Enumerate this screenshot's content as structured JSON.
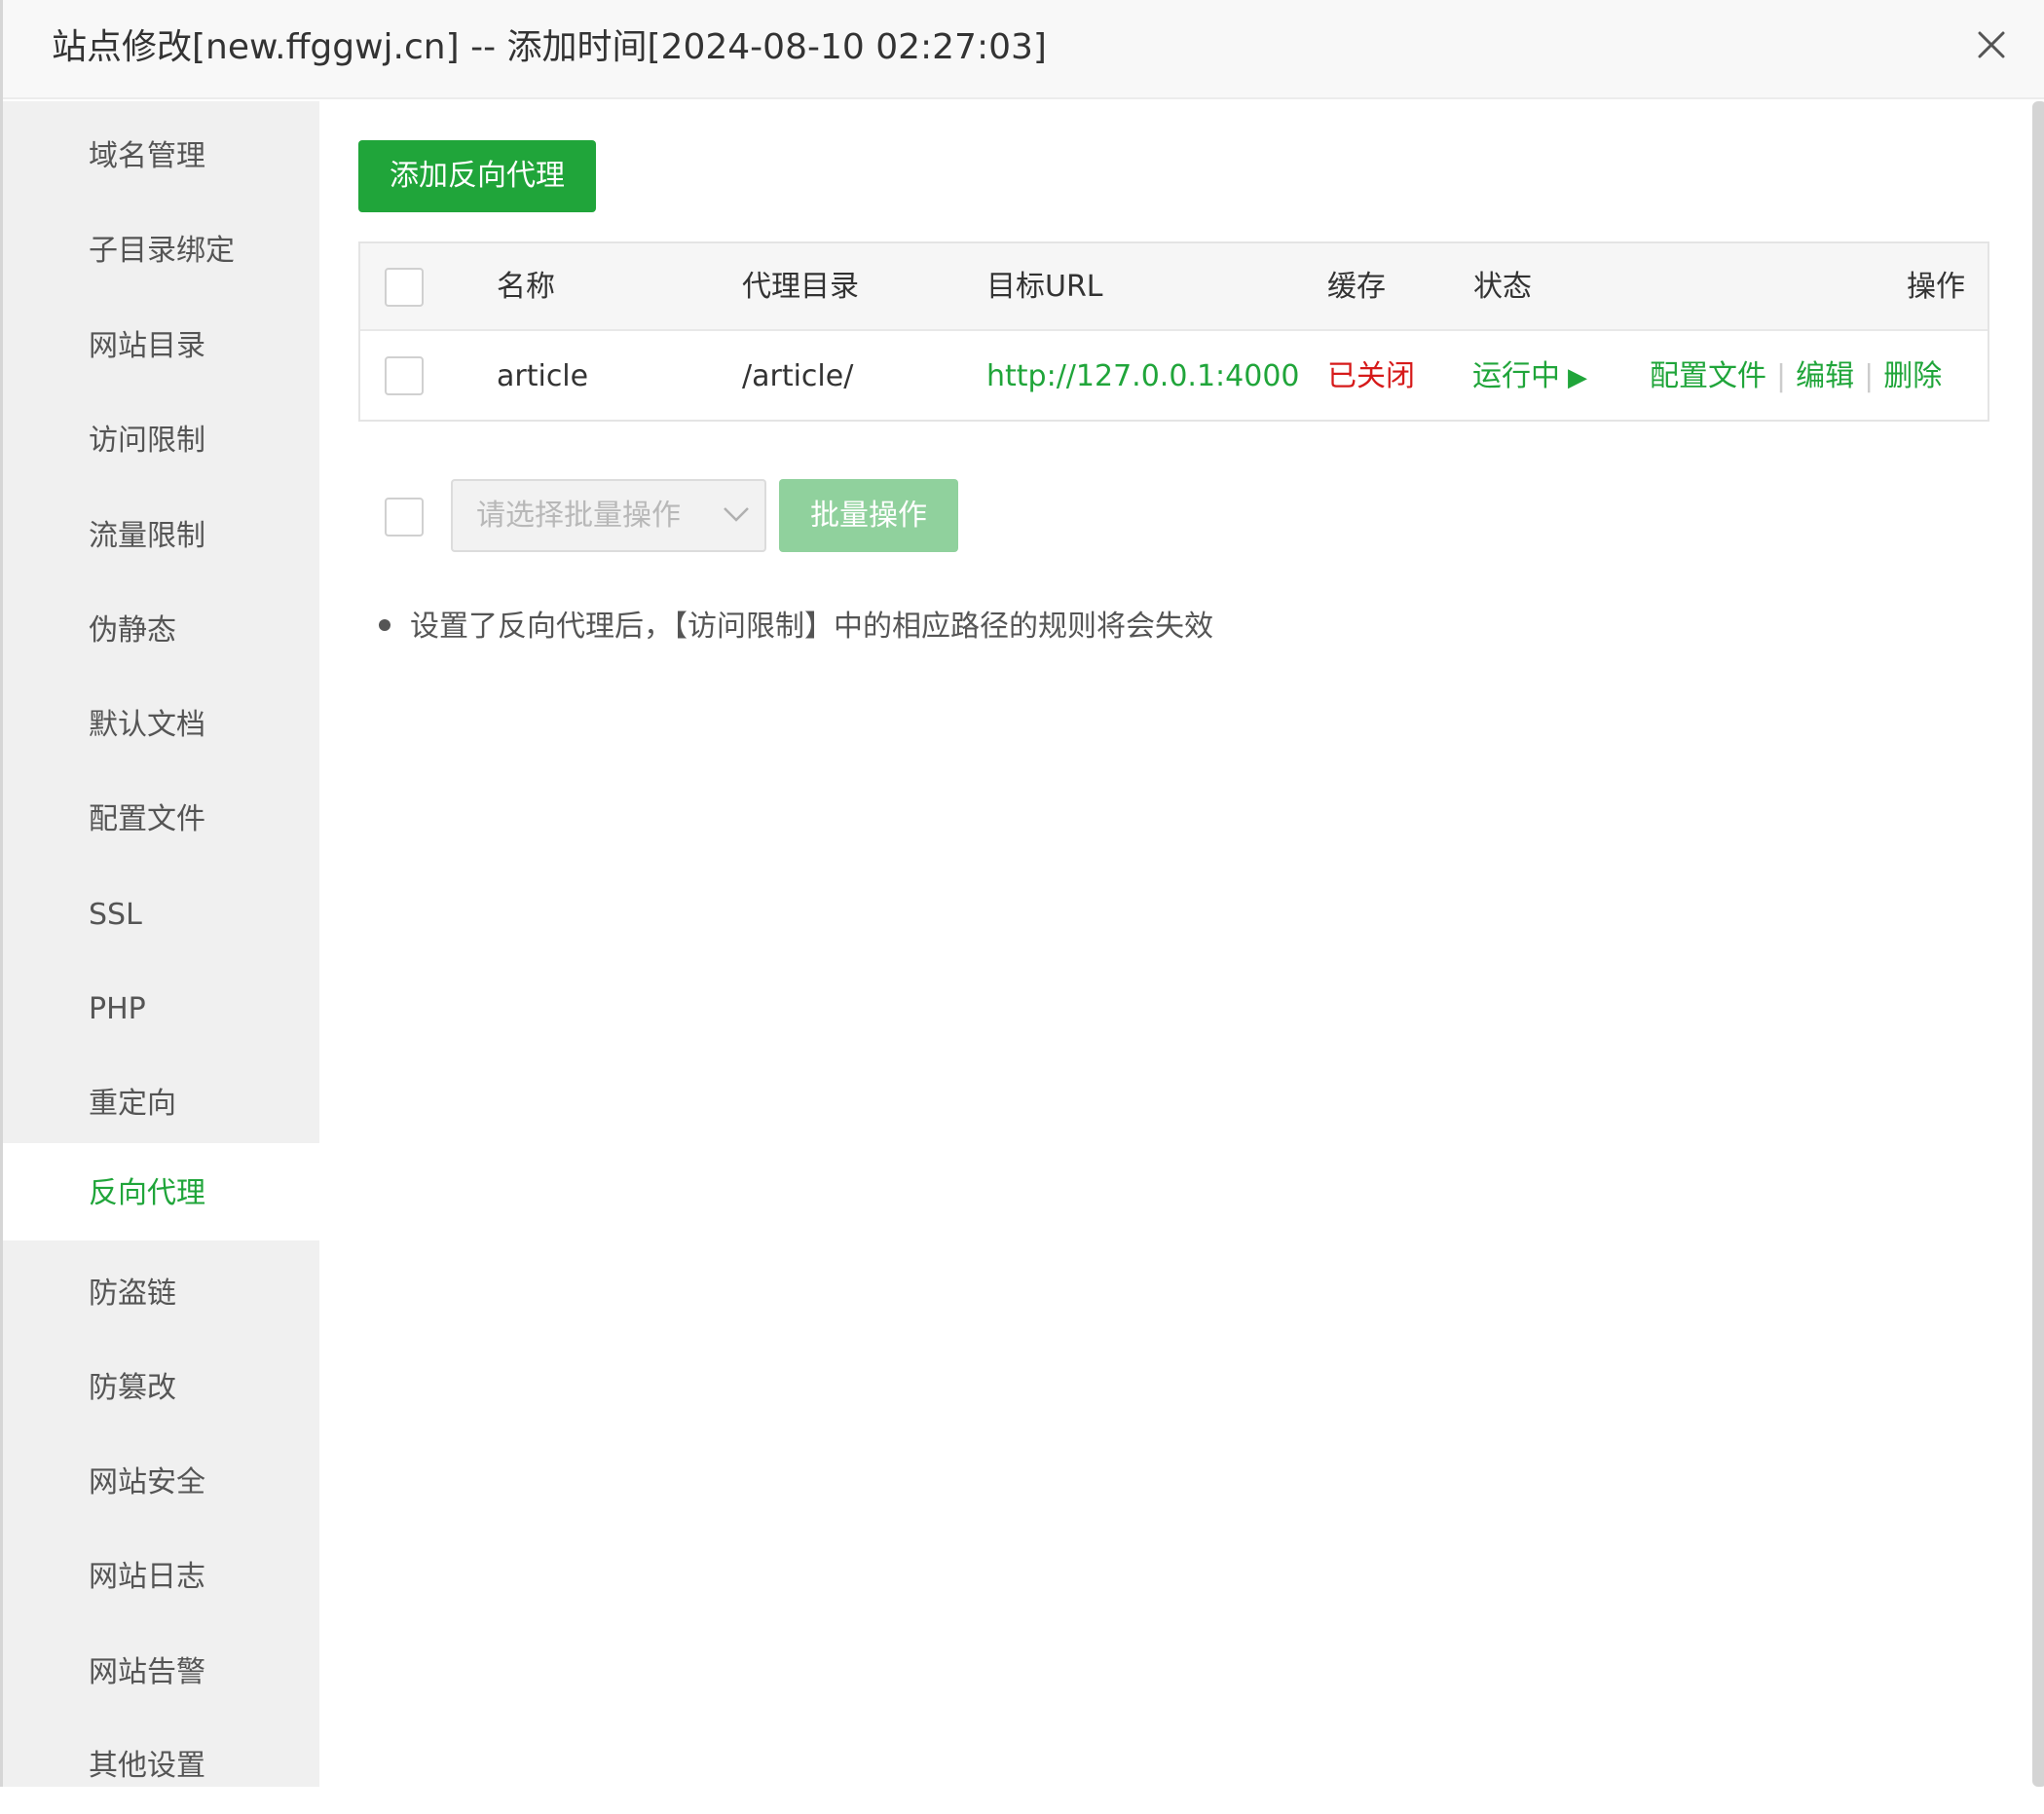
{
  "dialog": {
    "title": "站点修改[new.ffggwj.cn] -- 添加时间[2024-08-10 02:27:03]",
    "close_icon": "close-icon"
  },
  "sidebar": {
    "active_index": 11,
    "items": [
      {
        "label": "域名管理"
      },
      {
        "label": "子目录绑定"
      },
      {
        "label": "网站目录"
      },
      {
        "label": "访问限制"
      },
      {
        "label": "流量限制"
      },
      {
        "label": "伪静态"
      },
      {
        "label": "默认文档"
      },
      {
        "label": "配置文件"
      },
      {
        "label": "SSL"
      },
      {
        "label": "PHP"
      },
      {
        "label": "重定向"
      },
      {
        "label": "反向代理"
      },
      {
        "label": "防盗链"
      },
      {
        "label": "防篡改"
      },
      {
        "label": "网站安全"
      },
      {
        "label": "网站日志"
      },
      {
        "label": "网站告警"
      },
      {
        "label": "其他设置"
      }
    ]
  },
  "toolbar": {
    "add_label": "添加反向代理"
  },
  "table": {
    "headers": {
      "name": "名称",
      "proxy_dir": "代理目录",
      "target_url": "目标URL",
      "cache": "缓存",
      "status": "状态",
      "actions": "操作"
    },
    "rows": [
      {
        "name": "article",
        "proxy_dir": "/article/",
        "target_url": "http://127.0.0.1:4000",
        "cache": "已关闭",
        "status": "运行中",
        "status_icon": "play-icon",
        "action_config": "配置文件",
        "action_edit": "编辑",
        "action_delete": "删除"
      }
    ]
  },
  "batch": {
    "placeholder": "请选择批量操作",
    "button_label": "批量操作"
  },
  "tips": [
    "设置了反向代理后，【访问限制】中的相应路径的规则将会失效"
  ],
  "colors": {
    "accent": "#20a53a",
    "danger": "#d61a1a",
    "sidebar_bg": "#f0f0f0",
    "disabled_button": "#90d19d"
  }
}
